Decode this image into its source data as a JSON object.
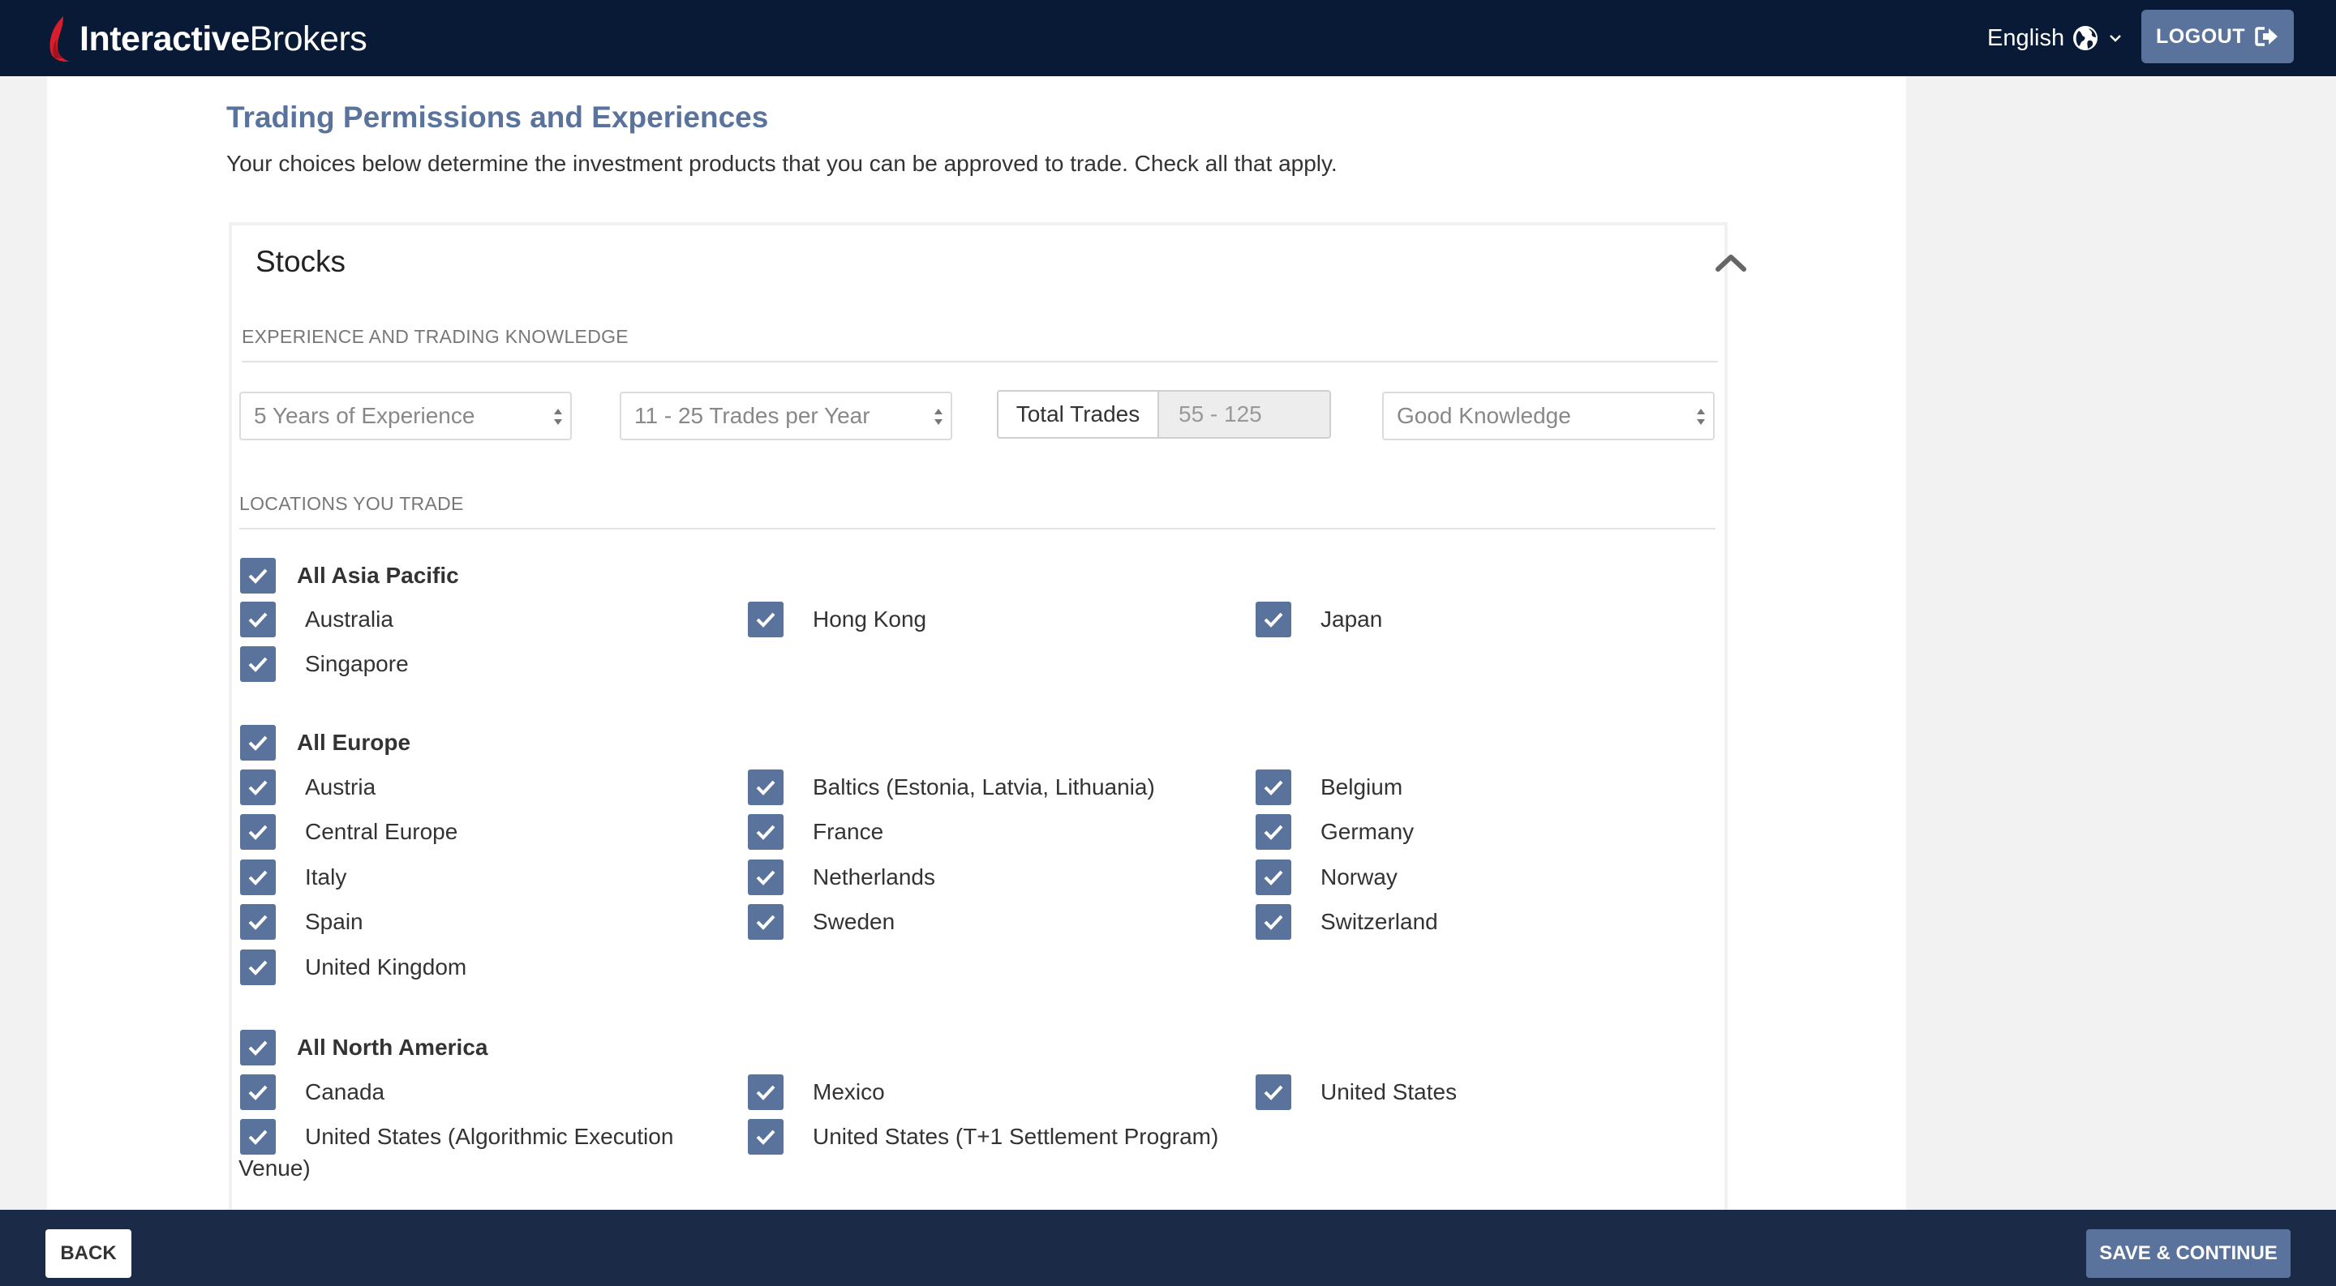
{
  "header": {
    "logo_bold": "Interactive",
    "logo_regular": "Brokers",
    "language": "English",
    "logout_label": "LOGOUT"
  },
  "page": {
    "title": "Trading Permissions and Experiences",
    "description": "Your choices below determine the investment products that you can be approved to trade. Check all that apply."
  },
  "stocks": {
    "title": "Stocks",
    "experience_heading": "EXPERIENCE AND TRADING KNOWLEDGE",
    "years_experience": "5 Years of Experience",
    "trades_per_year": "11 - 25 Trades per Year",
    "total_trades_label": "Total Trades",
    "total_trades_value": "55 - 125",
    "knowledge": "Good Knowledge",
    "locations_heading": "LOCATIONS YOU TRADE",
    "asia_pacific": {
      "group": "All Asia Pacific",
      "items": [
        "Australia",
        "Hong Kong",
        "Japan",
        "Singapore"
      ]
    },
    "europe": {
      "group": "All Europe",
      "items": [
        "Austria",
        "Baltics (Estonia, Latvia, Lithuania)",
        "Belgium",
        "Central Europe",
        "France",
        "Germany",
        "Italy",
        "Netherlands",
        "Norway",
        "Spain",
        "Sweden",
        "Switzerland",
        "United Kingdom"
      ]
    },
    "north_america": {
      "group": "All North America",
      "items": [
        "Canada",
        "Mexico",
        "United States",
        "United States (Algorithmic Execution",
        "United States (T+1 Settlement Program)"
      ],
      "wrap_tail": "Venue)"
    }
  },
  "footer": {
    "back_label": "BACK",
    "save_label": "SAVE & CONTINUE"
  },
  "colors": {
    "header_bg": "#081a35",
    "footer_bg": "#1b2a47",
    "accent": "#5a739c",
    "logo_red": "#d81e2c"
  }
}
